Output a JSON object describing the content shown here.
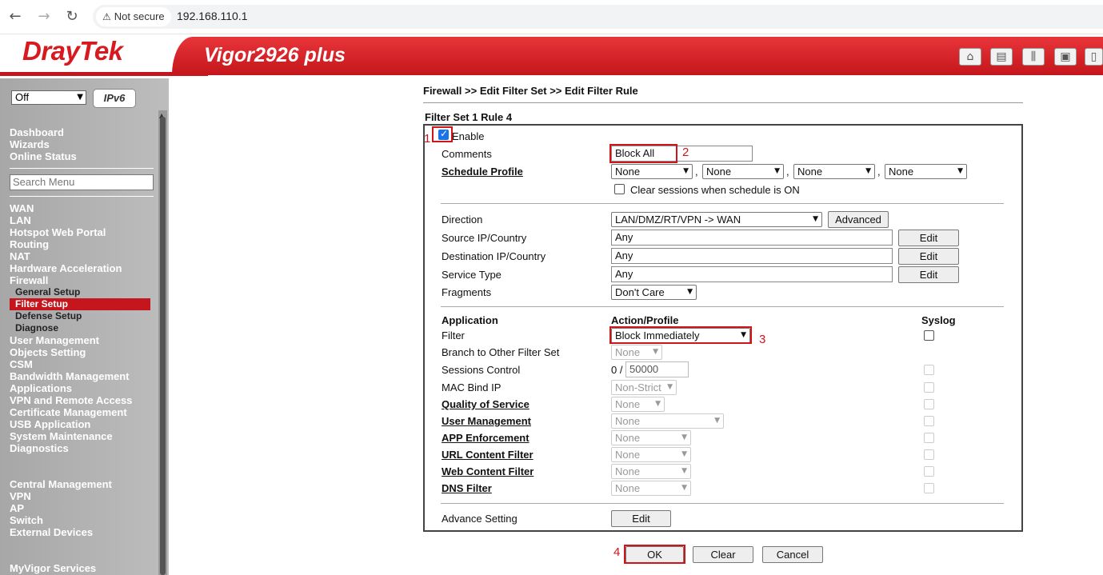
{
  "browser": {
    "back_icon": "arrow-left-icon",
    "forward_icon": "arrow-right-icon",
    "reload_icon": "reload-icon",
    "security_label": "Not secure",
    "url": "192.168.110.1"
  },
  "header": {
    "logo": "DrayTek",
    "model": "Vigor2926 plus",
    "icons": [
      "home-icon",
      "layout-icon",
      "sliders-icon",
      "save-icon",
      "book-icon"
    ]
  },
  "sidebar": {
    "mode_select": "Off",
    "ipv6_label": "IPv6",
    "top_items": [
      "Dashboard",
      "Wizards",
      "Online Status"
    ],
    "search_placeholder": "Search Menu",
    "items": [
      {
        "label": "WAN"
      },
      {
        "label": "LAN"
      },
      {
        "label": "Hotspot Web Portal"
      },
      {
        "label": "Routing"
      },
      {
        "label": "NAT"
      },
      {
        "label": "Hardware Acceleration"
      },
      {
        "label": "Firewall"
      }
    ],
    "firewall_sub": [
      "General Setup",
      "Filter Setup",
      "Defense Setup",
      "Diagnose"
    ],
    "items2": [
      {
        "label": "User Management"
      },
      {
        "label": "Objects Setting"
      },
      {
        "label": "CSM"
      },
      {
        "label": "Bandwidth Management"
      },
      {
        "label": "Applications"
      },
      {
        "label": "VPN and Remote Access"
      },
      {
        "label": "Certificate Management"
      },
      {
        "label": "USB Application"
      },
      {
        "label": "System Maintenance"
      },
      {
        "label": "Diagnostics"
      }
    ],
    "central": [
      "Central Management",
      "VPN",
      "AP",
      "Switch",
      "External Devices"
    ],
    "myvigor": "MyVigor Services"
  },
  "main": {
    "breadcrumb": "Firewall >> Edit Filter Set >> Edit Filter Rule",
    "rule_title": "Filter Set 1 Rule 4",
    "enable_label": "Enable",
    "enable_checked": true,
    "comments_label": "Comments",
    "comments_value": "Block All",
    "schedule_label": "Schedule Profile",
    "schedule_values": [
      "None",
      "None",
      "None",
      "None"
    ],
    "schedule_sep": ",",
    "clear_sessions_label": "Clear sessions when schedule is ON",
    "direction_label": "Direction",
    "direction_value": "LAN/DMZ/RT/VPN -> WAN",
    "advanced_button": "Advanced",
    "source_label": "Source IP/Country",
    "source_value": "Any",
    "dest_label": "Destination IP/Country",
    "dest_value": "Any",
    "service_label": "Service Type",
    "service_value": "Any",
    "edit_button": "Edit",
    "fragments_label": "Fragments",
    "fragments_value": "Don't Care",
    "col_application": "Application",
    "col_action": "Action/Profile",
    "col_syslog": "Syslog",
    "filter_label": "Filter",
    "filter_value": "Block Immediately",
    "branch_label": "Branch to Other Filter Set",
    "branch_value": "None",
    "sessions_label": "Sessions Control",
    "sessions_prefix": "0 /",
    "sessions_value": "50000",
    "mac_label": "MAC Bind IP",
    "mac_value": "Non-Strict",
    "qos_label": "Quality of Service",
    "qos_value": "None",
    "um_label": "User Management",
    "um_value": "None",
    "app_label": "APP Enforcement",
    "app_value": "None",
    "url_label": "URL Content Filter",
    "url_value": "None",
    "web_label": "Web Content Filter",
    "web_value": "None",
    "dns_label": "DNS Filter",
    "dns_value": "None",
    "advance_label": "Advance Setting",
    "advance_button": "Edit",
    "ok_button": "OK",
    "clear_button": "Clear",
    "cancel_button": "Cancel"
  },
  "annotations": [
    "1",
    "2",
    "3",
    "4"
  ],
  "colors": {
    "brand_red": "#c4161c",
    "annotation_red": "#d0141c",
    "checkbox_blue": "#1a73e8"
  }
}
